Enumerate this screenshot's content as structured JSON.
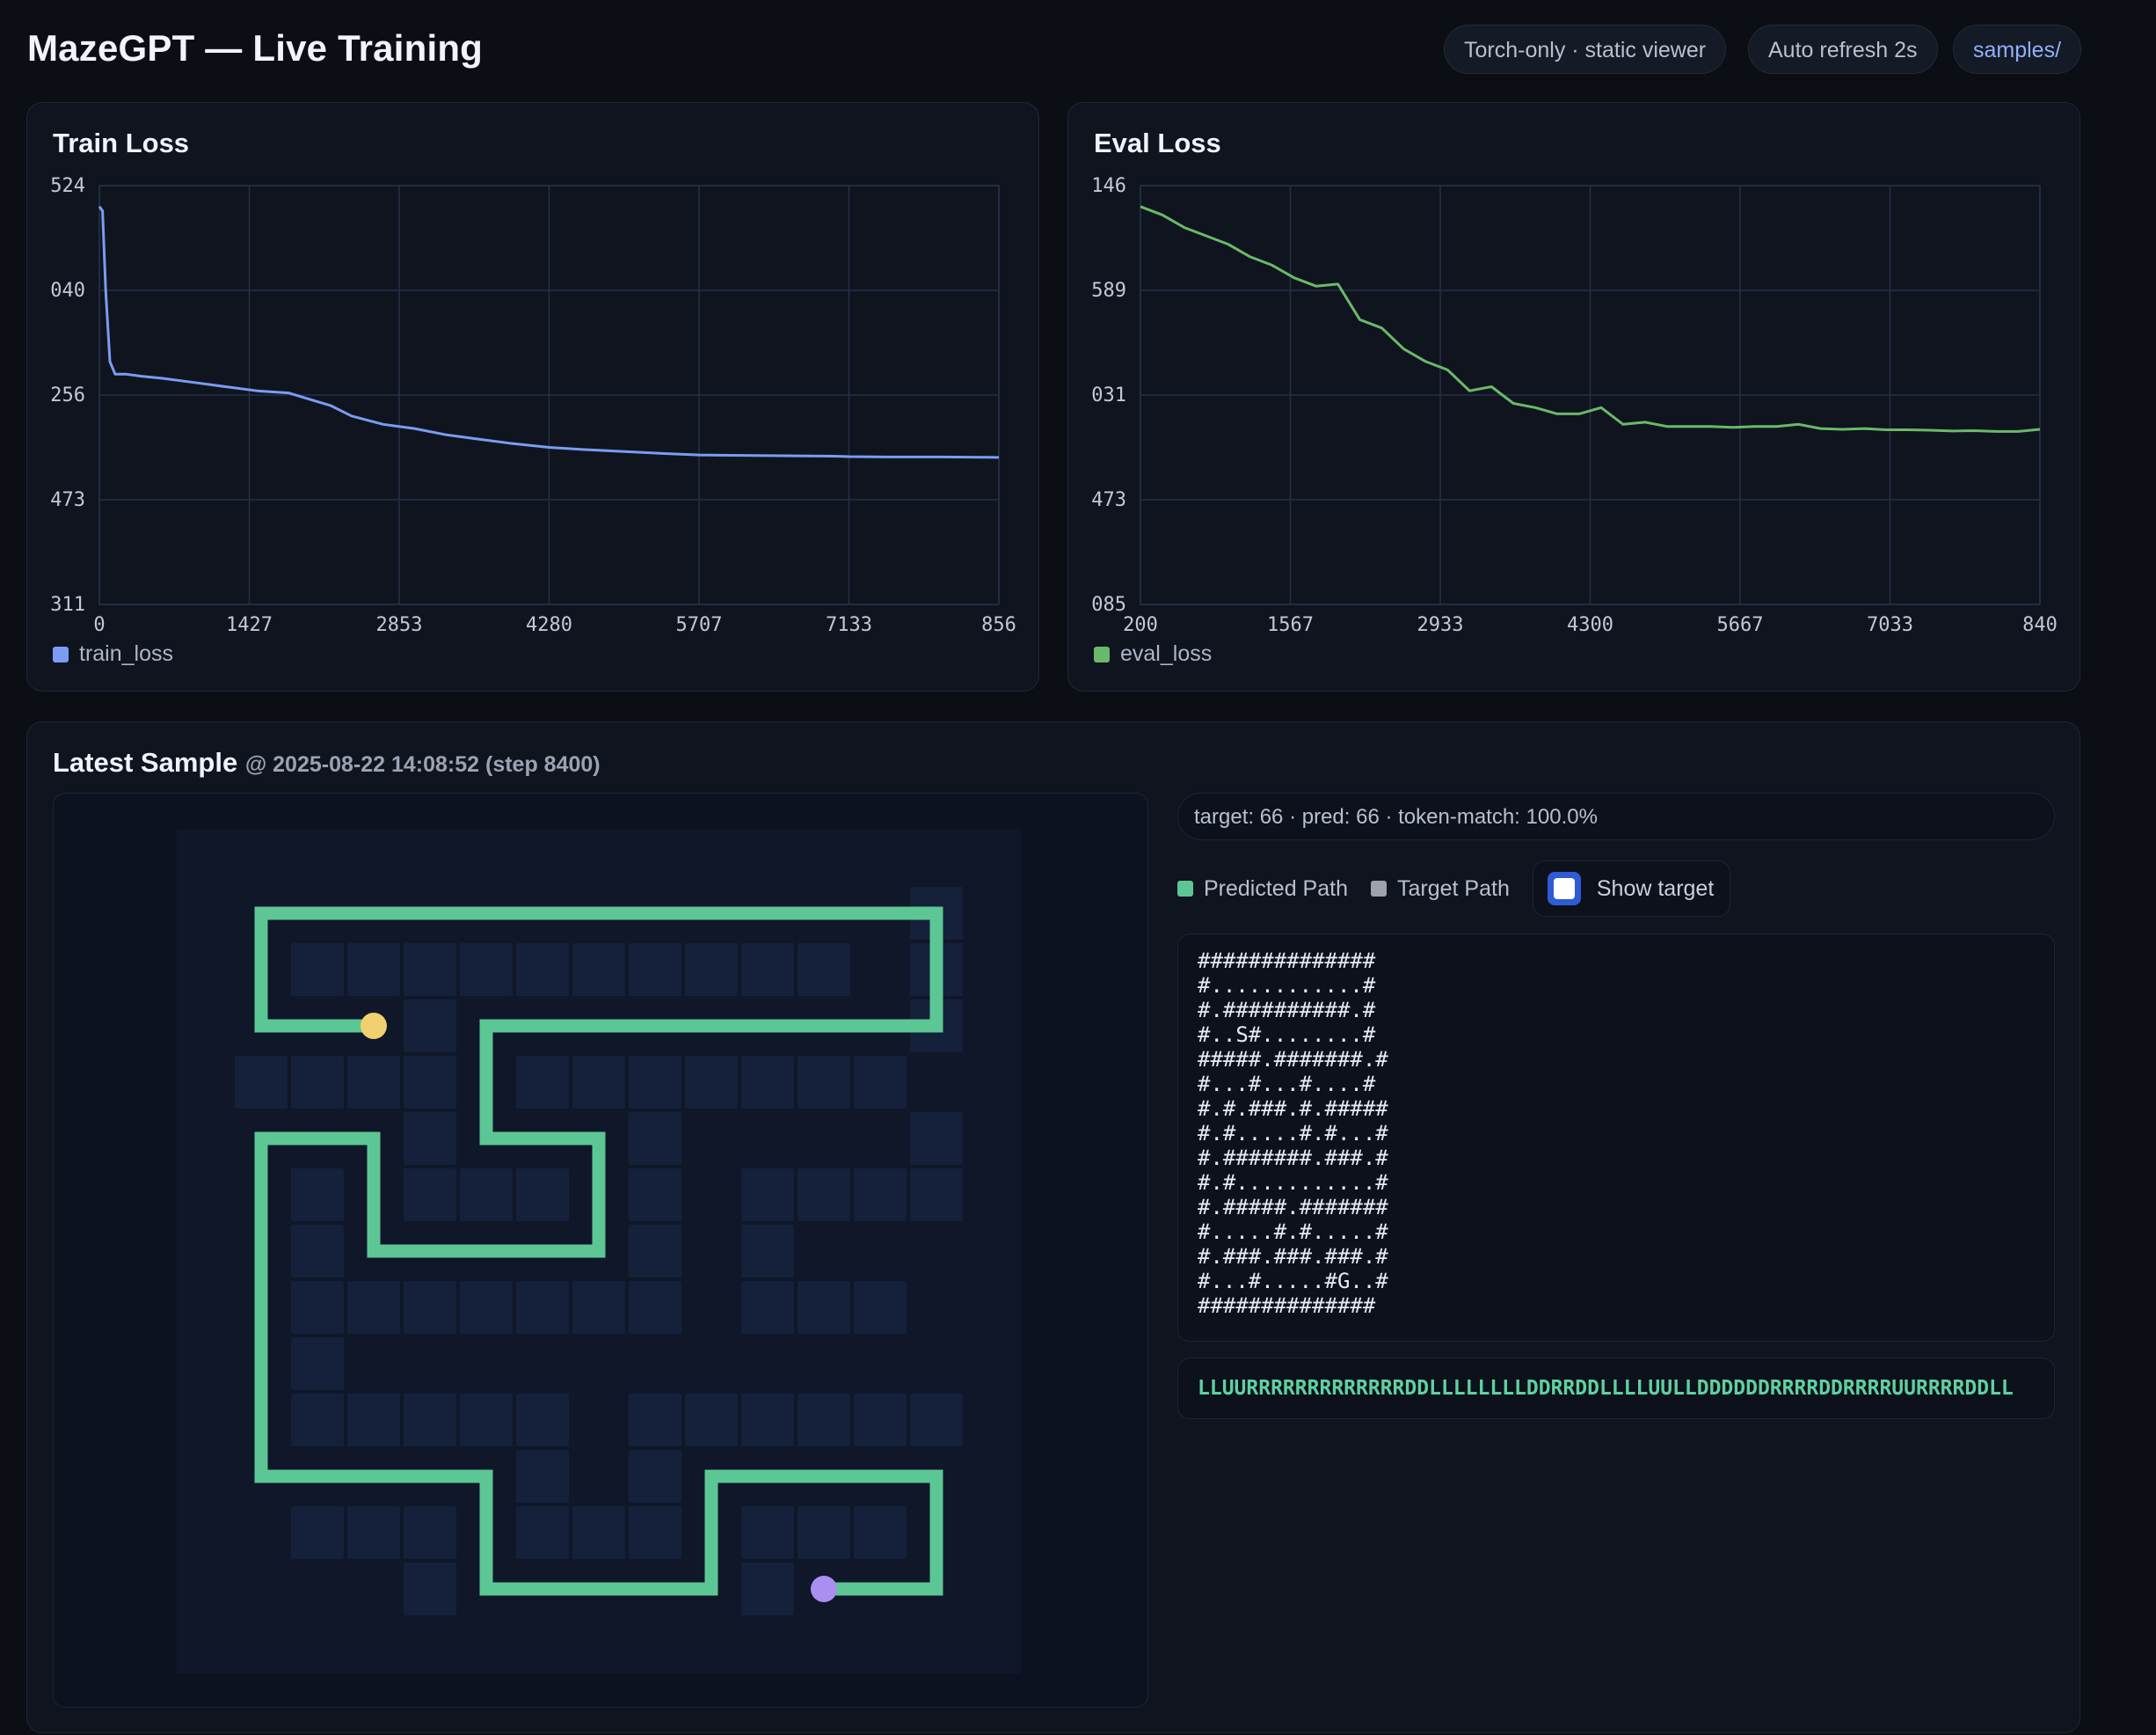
{
  "header": {
    "title": "MazeGPT — Live Training",
    "pills": [
      {
        "label": "Torch-only · static viewer"
      },
      {
        "label": "Auto refresh 2s"
      },
      {
        "label": "samples/"
      }
    ]
  },
  "colors": {
    "train": "#7b9cf2",
    "eval": "#6ab96a",
    "path": "#5cc794",
    "target_swatch": "#9ea3ab",
    "start": "#f2cf6f",
    "goal": "#a98ff0"
  },
  "charts": {
    "train": {
      "title": "Train Loss",
      "legend": "train_loss",
      "y_ticks": [
        "524",
        "040",
        "256",
        "473",
        "311"
      ],
      "x_ticks": [
        "0",
        "1427",
        "2853",
        "4280",
        "5707",
        "7133",
        "856"
      ]
    },
    "eval": {
      "title": "Eval Loss",
      "legend": "eval_loss",
      "y_ticks": [
        "146",
        "589",
        "031",
        "473",
        "085"
      ],
      "x_ticks": [
        "200",
        "1567",
        "2933",
        "4300",
        "5667",
        "7033",
        "840"
      ]
    }
  },
  "chart_data": [
    {
      "type": "line",
      "title": "Train Loss",
      "xlim": [
        0,
        8560
      ],
      "series": [
        {
          "name": "train_loss",
          "x": [
            0,
            30,
            60,
            100,
            150,
            250,
            400,
            600,
            900,
            1200,
            1500,
            1800,
            2000,
            2200,
            2400,
            2700,
            3000,
            3300,
            3600,
            3900,
            4280,
            4600,
            5000,
            5400,
            5707,
            6000,
            6500,
            7000,
            7133,
            7500,
            8000,
            8560
          ],
          "y": [
            0.95,
            0.94,
            0.75,
            0.58,
            0.55,
            0.55,
            0.545,
            0.54,
            0.53,
            0.52,
            0.51,
            0.505,
            0.49,
            0.475,
            0.45,
            0.43,
            0.42,
            0.405,
            0.395,
            0.385,
            0.375,
            0.37,
            0.365,
            0.36,
            0.357,
            0.356,
            0.355,
            0.354,
            0.353,
            0.352,
            0.352,
            0.351
          ]
        }
      ]
    },
    {
      "type": "line",
      "title": "Eval Loss",
      "xlim": [
        200,
        8400
      ],
      "series": [
        {
          "name": "eval_loss",
          "x": [
            200,
            400,
            600,
            800,
            1000,
            1200,
            1400,
            1600,
            1800,
            2000,
            2200,
            2400,
            2600,
            2800,
            3000,
            3200,
            3400,
            3600,
            3800,
            4000,
            4200,
            4400,
            4600,
            4800,
            5000,
            5200,
            5400,
            5600,
            5800,
            6000,
            6200,
            6400,
            6600,
            6800,
            7000,
            7200,
            7400,
            7600,
            7800,
            8000,
            8200,
            8400
          ],
          "y": [
            0.95,
            0.93,
            0.9,
            0.88,
            0.86,
            0.83,
            0.81,
            0.78,
            0.76,
            0.765,
            0.68,
            0.66,
            0.61,
            0.58,
            0.56,
            0.51,
            0.52,
            0.48,
            0.47,
            0.455,
            0.455,
            0.47,
            0.43,
            0.435,
            0.425,
            0.425,
            0.425,
            0.423,
            0.425,
            0.425,
            0.43,
            0.42,
            0.418,
            0.42,
            0.417,
            0.417,
            0.416,
            0.414,
            0.415,
            0.413,
            0.413,
            0.418
          ]
        }
      ]
    }
  ],
  "sample": {
    "title": "Latest Sample",
    "meta": "@ 2025-08-22 14:08:52 (step 8400)",
    "stats": "target: 66 · pred: 66 · token-match: 100.0%",
    "legend_pred": "Predicted Path",
    "legend_target": "Target Path",
    "show_target_label": "Show target",
    "show_target_checked": false,
    "ascii": [
      "##############",
      "#............#",
      "#.##########.#",
      "#..S#........#",
      "#####.#######.#",
      "#...#...#....#",
      "#.#.###.#.#####",
      "#.#.....#.#...#",
      "#.#######.###.#",
      "#.#...........#",
      "#.#####.#######",
      "#.....#.#.....#",
      "#.###.###.###.#",
      "#...#.....#G..#",
      "##############"
    ],
    "moves": "LLUURRRRRRRRRRRRRDDLLLLLLLLDDRRDDLLLLUULLDDDDDDRRRRDDRRRRUURRRRDDLL"
  },
  "maze": {
    "rows": 15,
    "cols": 15,
    "path": [
      [
        3,
        3
      ],
      [
        3,
        2
      ],
      [
        3,
        1
      ],
      [
        2,
        1
      ],
      [
        1,
        1
      ],
      [
        1,
        2
      ],
      [
        1,
        3
      ],
      [
        1,
        4
      ],
      [
        1,
        5
      ],
      [
        1,
        6
      ],
      [
        1,
        7
      ],
      [
        1,
        8
      ],
      [
        1,
        9
      ],
      [
        1,
        10
      ],
      [
        1,
        11
      ],
      [
        1,
        12
      ],
      [
        1,
        13
      ],
      [
        2,
        13
      ],
      [
        3,
        13
      ],
      [
        3,
        12
      ],
      [
        3,
        11
      ],
      [
        3,
        10
      ],
      [
        3,
        9
      ],
      [
        3,
        8
      ],
      [
        3,
        7
      ],
      [
        3,
        6
      ],
      [
        3,
        5
      ],
      [
        4,
        5
      ],
      [
        5,
        5
      ],
      [
        5,
        6
      ],
      [
        5,
        7
      ],
      [
        6,
        7
      ],
      [
        7,
        7
      ],
      [
        7,
        6
      ],
      [
        7,
        5
      ],
      [
        7,
        4
      ],
      [
        7,
        3
      ],
      [
        6,
        3
      ],
      [
        5,
        3
      ],
      [
        5,
        2
      ],
      [
        5,
        1
      ],
      [
        6,
        1
      ],
      [
        7,
        1
      ],
      [
        8,
        1
      ],
      [
        9,
        1
      ],
      [
        10,
        1
      ],
      [
        11,
        1
      ],
      [
        11,
        2
      ],
      [
        11,
        3
      ],
      [
        11,
        4
      ],
      [
        11,
        5
      ],
      [
        12,
        5
      ],
      [
        13,
        5
      ],
      [
        13,
        6
      ],
      [
        13,
        7
      ],
      [
        13,
        8
      ],
      [
        13,
        9
      ],
      [
        12,
        9
      ],
      [
        11,
        9
      ],
      [
        11,
        10
      ],
      [
        11,
        11
      ],
      [
        11,
        12
      ],
      [
        11,
        13
      ],
      [
        12,
        13
      ],
      [
        13,
        13
      ],
      [
        13,
        12
      ],
      [
        13,
        11
      ]
    ],
    "start": [
      3,
      3
    ],
    "goal": [
      13,
      11
    ]
  }
}
